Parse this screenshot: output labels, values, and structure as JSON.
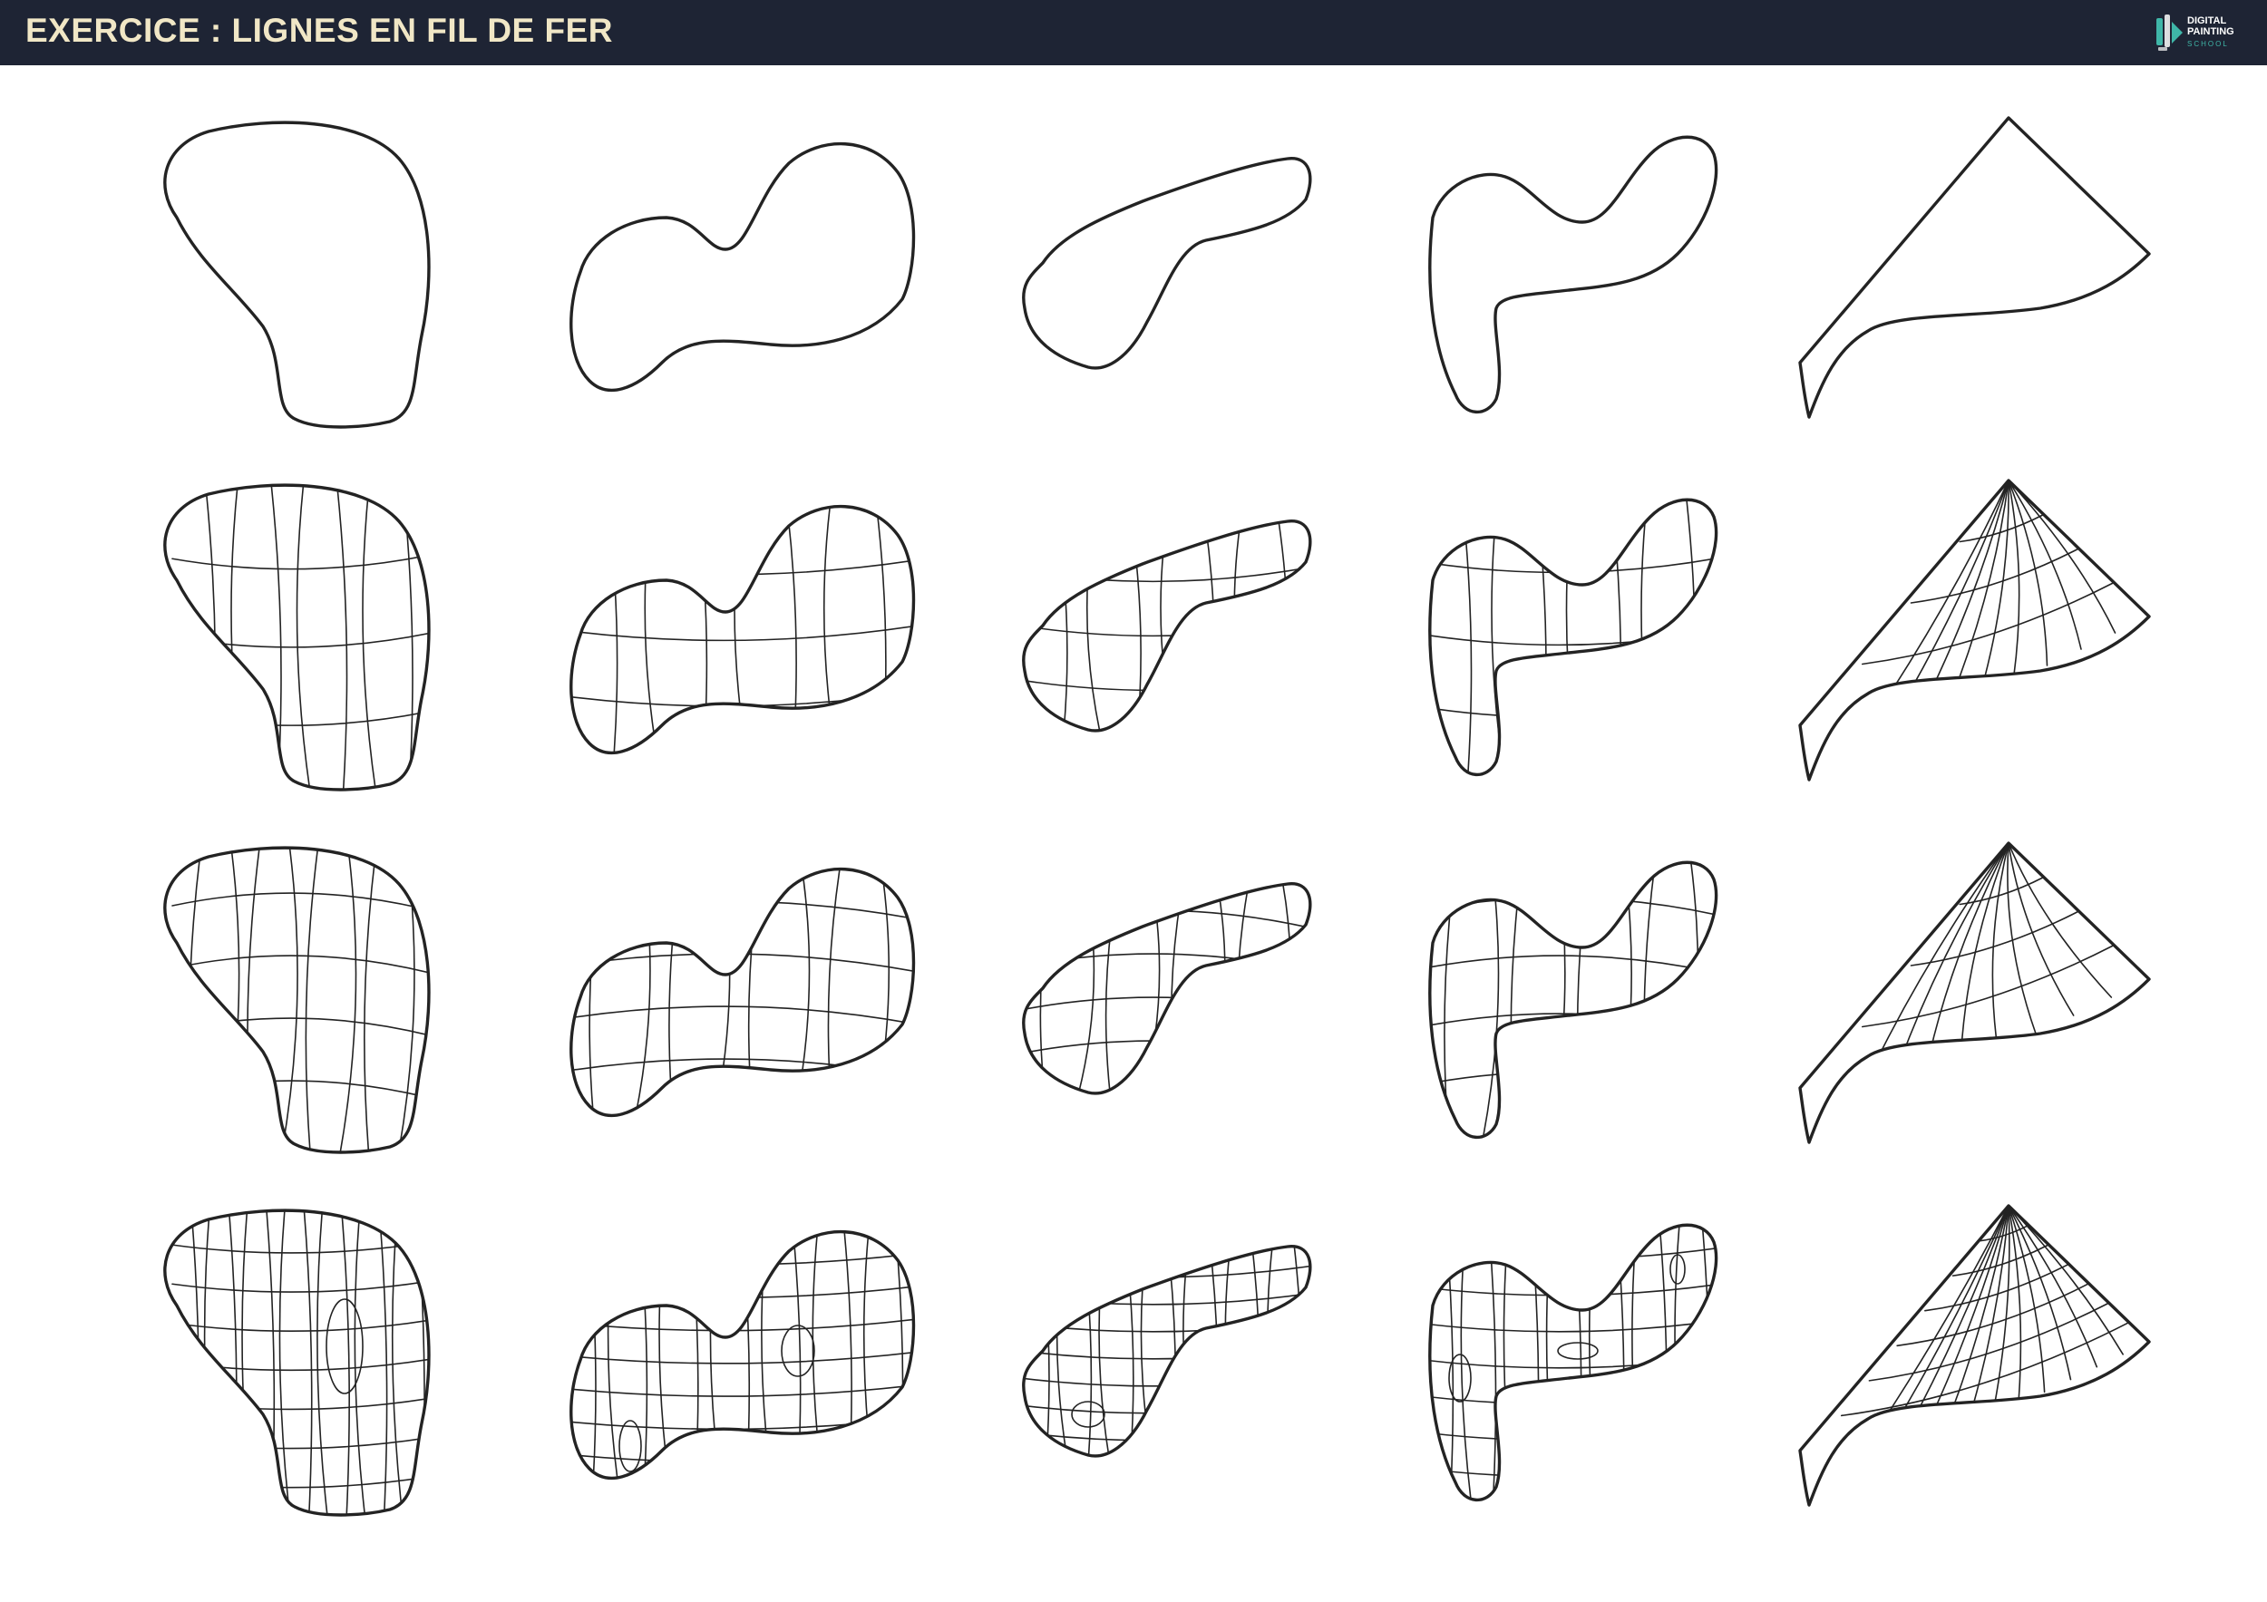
{
  "header": {
    "title": "EXERCICE : LIGNES EN FIL DE FER",
    "title_color": "#f1e7c6",
    "background": "#1e2434"
  },
  "logo": {
    "line1": "DIGITAL",
    "line2": "PAINTING",
    "line3": "SCHOOL",
    "accent_color": "#3fb6a8",
    "icon": "brush-pen-icon"
  },
  "sheet": {
    "rows": 4,
    "columns": 5,
    "row_states": [
      "outline-only",
      "wireframe-simple",
      "wireframe-variant",
      "wireframe-dense-with-holes"
    ],
    "line_color": "#232323"
  }
}
